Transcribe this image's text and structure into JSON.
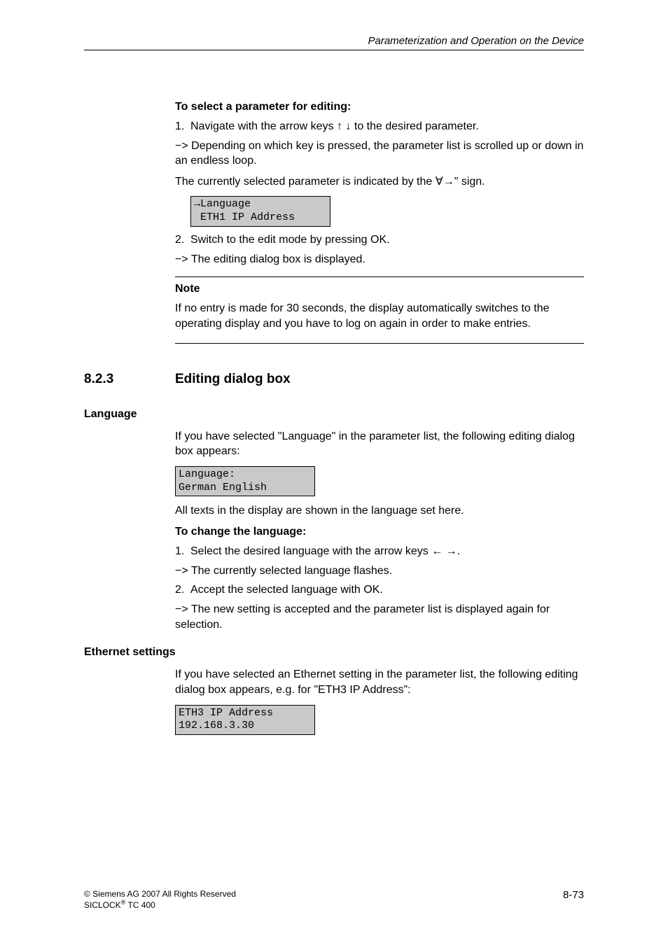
{
  "header": {
    "title": "Parameterization and Operation on the Device"
  },
  "section1": {
    "heading": "To select a parameter for editing:",
    "step1_num": "1.",
    "step1_text_a": "Navigate with the arrow keys ",
    "step1_arrows": "↑ ↓",
    "step1_text_b": " to the desired parameter.",
    "sub1_prefix": "−> ",
    "sub1_text": "Depending on which key is pressed, the parameter list is scrolled up or down in an endless loop.",
    "sub2_a": "The currently selected parameter is indicated by the ",
    "sub2_sym": "∀→\"",
    "sub2_b": " sign.",
    "display1_l1": "→Language",
    "display1_l2": " ETH1 IP Address",
    "step2_num": "2.",
    "step2_text": "Switch to the edit mode by pressing OK.",
    "sub3_prefix": "−> ",
    "sub3_text": "The editing dialog box is displayed.",
    "note_title": "Note",
    "note_body": "If no entry is made for 30 seconds, the display automatically switches to the operating display and you have to log on again in order to make entries."
  },
  "section2": {
    "num": "8.2.3",
    "title": "Editing dialog box"
  },
  "language": {
    "side": "Language",
    "intro": "If you have selected \"Language\" in the parameter list, the following editing dialog box appears:",
    "display_l1": "Language:",
    "display_l2": "German English",
    "after": "All texts in the display are shown in the language set here.",
    "heading": "To change the language:",
    "step1_num": "1.",
    "step1_a": "Select the desired language with the arrow keys ",
    "step1_arrows": "← →",
    "step1_b": ".",
    "sub1_prefix": "−> ",
    "sub1_text": "The currently selected language flashes.",
    "step2_num": "2.",
    "step2_text": "Accept the selected language with OK.",
    "sub2_prefix": "−> ",
    "sub2_text": "The new setting is accepted and the parameter list is displayed again for selection."
  },
  "ethernet": {
    "side": "Ethernet settings",
    "intro": "If you have selected an Ethernet setting in the parameter list, the following editing dialog box appears, e.g. for \"ETH3 IP Address\":",
    "display_l1": "ETH3 IP Address",
    "display_l2": "192.168.3.30"
  },
  "footer": {
    "copyright_a": "© Siemens AG 2007 All Rights Reserved",
    "copyright_b_a": " SICLOCK",
    "copyright_b_sup": "®",
    "copyright_b_b": " TC 400",
    "page": "8-73"
  }
}
